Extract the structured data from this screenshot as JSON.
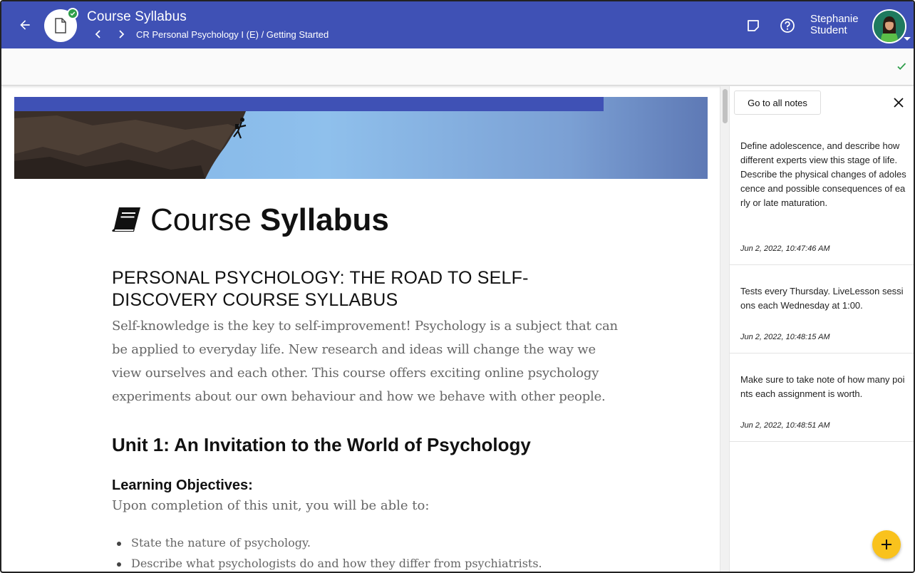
{
  "header": {
    "title": "Course Syllabus",
    "breadcrumb": "CR Personal Psychology I (E) / Getting Started",
    "user_first": "Stephanie",
    "user_last": "Student",
    "brand_color": "#3f51b5",
    "status_color": "#2e9e4a"
  },
  "icons": {
    "back": "arrow-left-icon",
    "doc": "document-icon",
    "prev": "chevron-left-icon",
    "next": "chevron-right-icon",
    "notes": "sticky-note-icon",
    "help": "help-circle-icon",
    "check": "check-icon",
    "close": "close-icon",
    "add": "plus-icon",
    "book": "book-icon"
  },
  "page": {
    "title_light": "Course",
    "title_bold": "Syllabus",
    "course_heading": "PERSONAL PSYCHOLOGY: THE ROAD TO SELF-DISCOVERY COURSE SYLLABUS",
    "intro": "Self-knowledge is the key to self-improvement! Psychology is a subject that can be applied to everyday life. New research and ideas will change the way we view ourselves and each other. This course offers exciting online psychology experiments about our own behaviour and how we behave with other people.",
    "unit_heading": "Unit 1: An Invitation to the World of Psychology",
    "objectives_heading": "Learning Objectives:",
    "objectives_intro": "Upon completion of this unit, you will be able to:",
    "objectives": [
      "State the nature of psychology.",
      "Describe what psychologists do and how they differ from psychiatrists."
    ]
  },
  "notes_panel": {
    "go_all_label": "Go to all notes",
    "notes": [
      {
        "text": "Define adolescence, and describe how different experts view this stage of life.\nDescribe the physical changes of adolescence and possible consequences of early or late maturation.",
        "date": "Jun 2, 2022, 10:47:46 AM"
      },
      {
        "text": "Tests every Thursday. LiveLesson sessions each Wednesday at 1:00.",
        "date": "Jun 2, 2022, 10:48:15 AM"
      },
      {
        "text": "Make sure to take note of how many points each assignment is worth.",
        "date": "Jun 2, 2022, 10:48:51 AM"
      }
    ]
  }
}
